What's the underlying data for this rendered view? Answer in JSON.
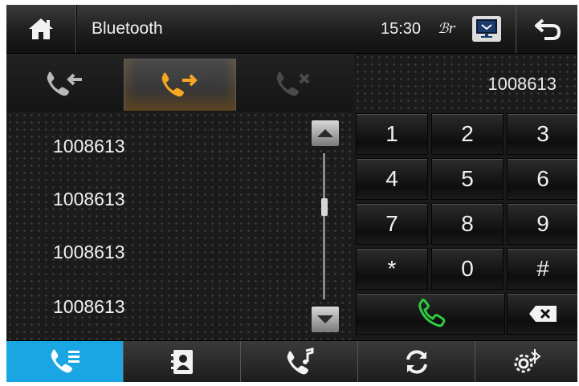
{
  "topbar": {
    "home_icon": "home-icon",
    "title": "Bluetooth",
    "time": "15:30",
    "bt_status": "ℬr",
    "screen_icon": "screen-icon",
    "back_icon": "back-arrow-icon"
  },
  "tabs": [
    {
      "icon": "incoming-call-icon",
      "active": false
    },
    {
      "icon": "outgoing-call-icon",
      "active": true
    },
    {
      "icon": "missed-call-icon",
      "active": false
    }
  ],
  "dial_display": "1008613",
  "call_list": [
    "1008613",
    "1008613",
    "1008613",
    "1008613"
  ],
  "keypad": {
    "keys": [
      "1",
      "2",
      "3",
      "4",
      "5",
      "6",
      "7",
      "8",
      "9",
      "*",
      "0",
      "#"
    ],
    "call_icon": "call-icon",
    "backspace_icon": "backspace-icon"
  },
  "bottom_nav": [
    {
      "icon": "call-log-icon",
      "active": true
    },
    {
      "icon": "contacts-icon",
      "active": false
    },
    {
      "icon": "music-call-icon",
      "active": false
    },
    {
      "icon": "sync-icon",
      "active": false
    },
    {
      "icon": "bluetooth-settings-icon",
      "active": false
    }
  ],
  "colors": {
    "accent": "#1aa6e3",
    "orange": "#f5a623",
    "green": "#2ecc40",
    "text": "#f0f0f0"
  }
}
